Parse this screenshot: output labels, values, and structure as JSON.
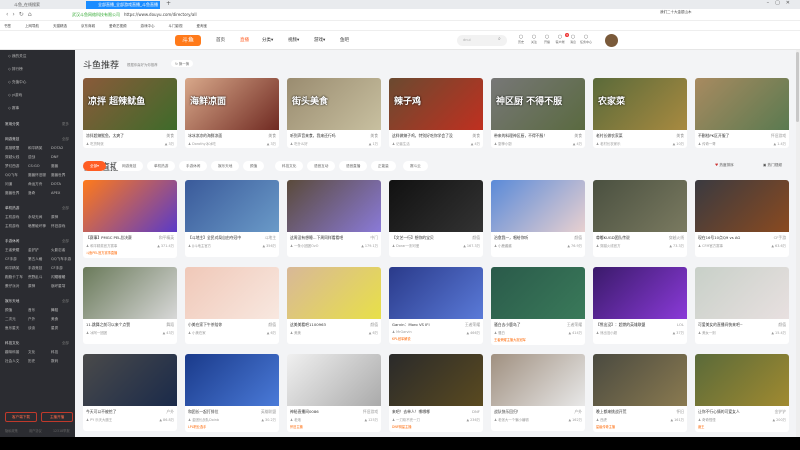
{
  "browser": {
    "tabs": [
      "斗鱼_在线搜索",
      "全部直播_全部游戏直播_斗鱼直播"
    ],
    "url_site": "武汉斗鱼网络科技有限公司",
    "url": "https://www.douyu.com/directory/all",
    "news": "我们二十大金银山木",
    "bookmarks": [
      "书签",
      "上网导航",
      "天猫精选",
      "京东商城",
      "爱奇艺视频",
      "游戏中心",
      "斗门影视",
      "爱淘宝"
    ]
  },
  "header": {
    "logo": "斗鱼",
    "nav": [
      "首页",
      "直播",
      "分类▾",
      "视频▾",
      "游戏▾",
      "鱼吧"
    ],
    "search_placeholder": "dnui",
    "icons": [
      "历史",
      "关注",
      "开播",
      "客户端",
      "消息",
      "任务中心"
    ],
    "badge": "3"
  },
  "sidebar": {
    "top": [
      "我的关注",
      "排行榜",
      "充值中心",
      "yi游戏",
      "赛事"
    ],
    "groups": [
      {
        "title": "常用分类",
        "more": "更多",
        "items": []
      },
      {
        "title": "网游竞技",
        "more": "全部",
        "items": [
          "英雄联盟",
          "和平精英",
          "DOTA2",
          "穿越火线",
          "逆战",
          "DNF",
          "梦幻西游",
          "CS:GO",
          "魔兽",
          "QQ飞车",
          "魔兽怀旧服",
          "魔兽世界",
          "问道",
          "命运方舟",
          "DOTA",
          "魔兽世界",
          "洛奇",
          "APEX"
        ]
      },
      {
        "title": "单机热游",
        "more": "全部",
        "items": [
          "主机游戏",
          "永劫无间",
          "原神",
          "主机游戏",
          "暗黑破坏神",
          "怀旧游戏"
        ]
      },
      {
        "title": "手游休闲",
        "more": "全部",
        "items": [
          "王者荣耀",
          "金铲铲",
          "火影忍者",
          "CF手游",
          "第五人格",
          "QQ飞车手游",
          "和平精英",
          "手游竞技",
          "CF手游",
          "跑跑卡丁车",
          "荒野乱斗",
          "闪耀暖暖",
          "蛋仔派对",
          "原神",
          "崩坏星穹"
        ]
      },
      {
        "title": "娱乐天地",
        "more": "全部",
        "items": [
          "颜值",
          "音乐",
          "舞蹈",
          "二次元",
          "户外",
          "美食",
          "鱼乐星天",
          "谈谈",
          "星秀"
        ]
      },
      {
        "title": "科技文化",
        "more": "全部",
        "items": [
          "趣味科普",
          "文化",
          "科技",
          "社会人文",
          "历史",
          "数码"
        ]
      }
    ],
    "buttons": [
      "客户端下载",
      "主播开播"
    ],
    "footer": [
      "隐私政策",
      "用户协议",
      "12318举报"
    ]
  },
  "recommend": {
    "title": "斗鱼推荐",
    "subtitle": "根据你喜好为你推荐",
    "refresh": "换一换",
    "cards": [
      {
        "cap": "凉拌 超辣鱿鱼",
        "title": "凉拌超辣鱿鱼，太爽了",
        "tag": "美食",
        "user": "吃货阿张",
        "hot": "3万",
        "c1": "#8a5a3a",
        "c2": "#3e6b2a"
      },
      {
        "cap": "海鲜凉面",
        "title": "冰冰凉凉的海鲜凉面",
        "tag": "美食",
        "user": "Dorothy冰冰吃",
        "hot": "3万",
        "c1": "#d8a88a",
        "c2": "#702a22"
      },
      {
        "cap": "街头美食",
        "title": "听到声音来食，我来还行吗",
        "tag": "美食",
        "user": "吃什么好",
        "hot": "1万",
        "c1": "#9a8c70",
        "c2": "#c8c0a0"
      },
      {
        "cap": "辣子鸡",
        "title": "这样做辣子鸡，特别好吃你学会了没",
        "tag": "美食",
        "user": "记者生活",
        "hot": "4万",
        "c1": "#6a4a30",
        "c2": "#c03020"
      },
      {
        "cap": "神区厨 不得不服",
        "title": "带来的料理神区厨，不得不服！",
        "tag": "美食",
        "user": "厨神小厨",
        "hot": "4万",
        "c1": "#777",
        "c2": "#5a6a40"
      },
      {
        "cap": "农家菜",
        "title": "老村长做农家菜",
        "tag": "美食",
        "user": "老村长农家乐",
        "hot": "10万",
        "c1": "#5a6a3a",
        "c2": "#a88a40"
      },
      {
        "cap": "",
        "title": "不删档PK区开服了",
        "tag": "怀旧游戏",
        "user": "传奇一哥",
        "hot": "1.4万",
        "c1": "#a88a60",
        "c2": "#5a7a50"
      }
    ]
  },
  "live": {
    "title": "在线直播",
    "filters": [
      "全部▾",
      "网游竞技",
      "单机热游",
      "手游休闲",
      "娱乐天地",
      "颜值",
      "科技文化",
      "语音互动",
      "语音直播",
      "正能量",
      "赛斗云"
    ],
    "links": [
      "热度排序",
      "热门视频"
    ],
    "cards": [
      {
        "title": "【赛事】PMGC PEL总决赛",
        "tag": "和平精英",
        "user": "和平精英官方赛事",
        "hot": "371.4万",
        "badge": "斗鱼PEL官方赛事直播",
        "c1": "#ff7a1a",
        "c2": "#5a3ac8"
      },
      {
        "title": "【斗地主】全民对局自由夺冠中",
        "tag": "斗地主",
        "user": "JJ斗地主官方",
        "hot": "356万",
        "badge": "",
        "c1": "#3a5a9a",
        "c2": "#6a9ac8"
      },
      {
        "title": "这周没有想睡…下周同样看看吧",
        "tag": "中门",
        "user": "一条小团团OvO",
        "hot": "179.1万",
        "badge": "",
        "c1": "#5a4a3a",
        "c2": "#8a7ad8"
      },
      {
        "title": "【文艺一行】想你的宝贝",
        "tag": "颜值",
        "user": "Dorar一则可爱",
        "hot": "167.3万",
        "badge": "",
        "c1": "#111",
        "c2": "#333"
      },
      {
        "title": "治愈我一，唱给你听",
        "tag": "颜值",
        "user": "小鹿酱酱",
        "hot": "76.9万",
        "badge": "",
        "c1": "#5a8ad8",
        "c2": "#e8d0d0"
      },
      {
        "title": "尊嘟KUGD团队传说",
        "tag": "穿越火线",
        "user": "穿越火线官方",
        "hot": "73.3万",
        "badge": "",
        "c1": "#4a5040",
        "c2": "#7a7a60"
      },
      {
        "title": "现在16号10点Q9 vs AG",
        "tag": "CF手游",
        "user": "CFM官方赛事",
        "hot": "63.6万",
        "badge": "",
        "c1": "#3a3a40",
        "c2": "#8a4a20"
      },
      {
        "title": "11.跳舞之前可以来个点赞",
        "tag": "舞蹈",
        "user": "冰阿一团团",
        "hot": "43万",
        "badge": "",
        "c1": "#6a7a5a",
        "c2": "#d8d8d8"
      },
      {
        "title": "小美在家下午茶陪你",
        "tag": "颜值",
        "user": "小美在家",
        "hot": "6万",
        "badge": "",
        "c1": "#f0c8b8",
        "c2": "#f8e8e0"
      },
      {
        "title": "这美美看吧1100963",
        "tag": "颜值",
        "user": "美美",
        "hot": "6万",
        "badge": "",
        "c1": "#d8b898",
        "c2": "#e8e048"
      },
      {
        "title": "Garvin：Moro VS IFI",
        "tag": "王者荣耀",
        "user": "MrGarvin",
        "hot": "466万",
        "badge": "KPL冠军解说",
        "c1": "#2a3a8a",
        "c2": "#5a7ad8"
      },
      {
        "title": "骚白去小鹿岛了",
        "tag": "王者荣耀",
        "user": "骚白",
        "hot": "414万",
        "badge": "王者荣耀主播大赛冠军",
        "c1": "#2a5a4a",
        "c2": "#3a7a5a"
      },
      {
        "title": "【熊出没】：超燃的英雄联盟",
        "tag": "LOL",
        "user": "熊出没小超",
        "hot": "37万",
        "badge": "",
        "c1": "#3a1a6a",
        "c2": "#8a3ad8"
      },
      {
        "title": "可爱美女的直播间快来吧~",
        "tag": "颜值",
        "user": "美女一则",
        "hot": "15.4万",
        "badge": "",
        "c1": "#c8d0c8",
        "c2": "#e8e0e0"
      },
      {
        "title": "今天可以不被挖了",
        "tag": "户外",
        "user": "PY 乐天大魔王",
        "hot": "86.8万",
        "badge": "",
        "c1": "#4a4a4a",
        "c2": "#1a2a4a"
      },
      {
        "title": "和团长一起打排位",
        "tag": "英雄联盟",
        "user": "金团长战队Doinb",
        "hot": "30.2万",
        "badge": "LPL职业选手",
        "c1": "#1a3a8a",
        "c2": "#4a7ad8"
      },
      {
        "title": "神秘直播间0086",
        "tag": "怀旧游戏",
        "user": "老炮",
        "hot": "125万",
        "badge": "怀旧主播",
        "c1": "#f0f0f0",
        "c2": "#aaa"
      },
      {
        "title": "来吧！去单人！哪哪哪",
        "tag": "DNF",
        "user": "一刀砍不完一刀",
        "hot": "236万",
        "badge": "DNF明星主播",
        "c1": "#2a2a2a",
        "c2": "#5a4a20"
      },
      {
        "title": "战队快乐回归！",
        "tag": "户外",
        "user": "老张大一个骗小编辑",
        "hot": "162万",
        "badge": "",
        "c1": "#a09080",
        "c2": "#e8e8e8"
      },
      {
        "title": "晚上都来挑战开荒",
        "tag": "怀旧",
        "user": "西虎",
        "hot": "161万",
        "badge": "星级传奇主播",
        "c1": "#4a4a40",
        "c2": "#8a7a50"
      },
      {
        "title": "让你不行心情的可爱女人",
        "tag": "金铲铲",
        "user": "奇奇怪怪",
        "hot": "200万",
        "badge": "魔王",
        "c1": "#5a6a3a",
        "c2": "#a08a30"
      }
    ]
  }
}
